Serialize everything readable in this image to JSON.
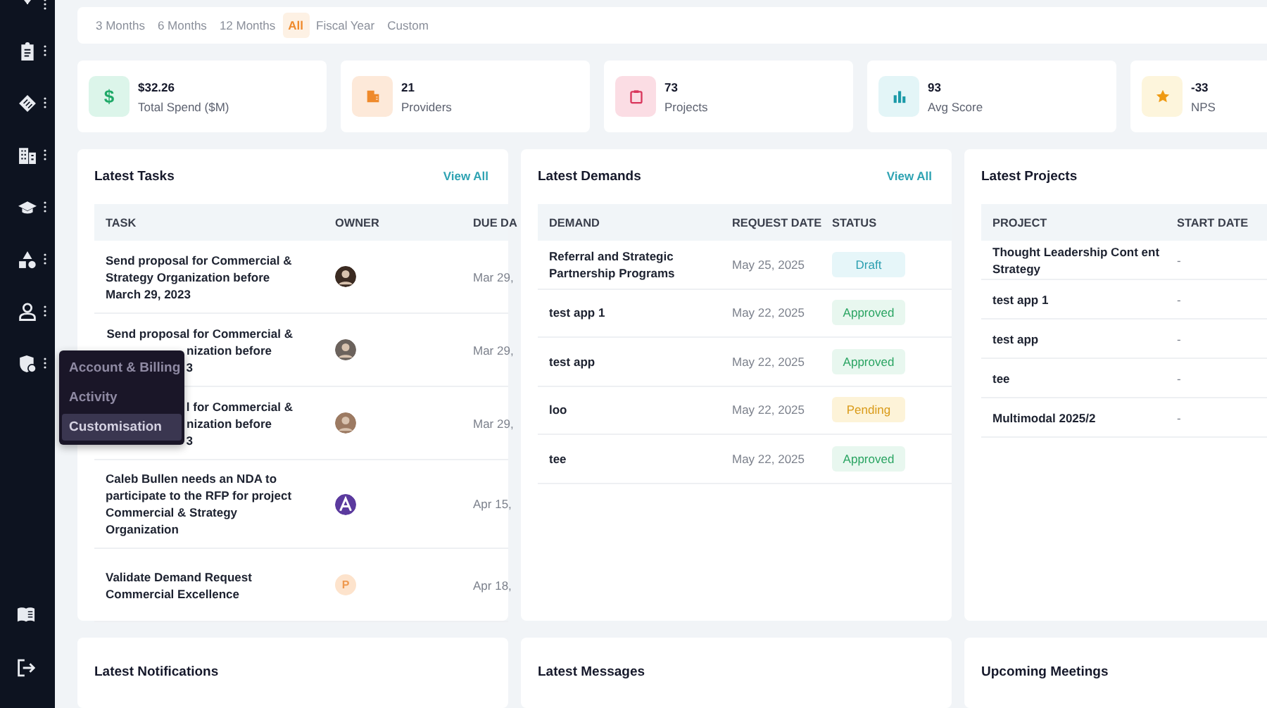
{
  "sidebar_menu": {
    "items": [
      {
        "label": "Account & Billing",
        "selected": false
      },
      {
        "label": "Activity",
        "selected": false
      },
      {
        "label": "Customisation",
        "selected": true
      }
    ]
  },
  "period_filter": [
    {
      "label": "3 Months",
      "selected": false
    },
    {
      "label": "6 Months",
      "selected": false
    },
    {
      "label": "12 Months",
      "selected": false
    },
    {
      "label": "All",
      "selected": true
    },
    {
      "label": "Fiscal Year",
      "selected": false
    },
    {
      "label": "Custom",
      "selected": false
    }
  ],
  "stats": [
    {
      "kind": "spend",
      "icon": "$",
      "value": "$32.26",
      "label": "Total Spend ($M)"
    },
    {
      "kind": "providers",
      "value": "21",
      "label": "Providers"
    },
    {
      "kind": "projects",
      "value": "73",
      "label": "Projects"
    },
    {
      "kind": "score",
      "value": "93",
      "label": "Avg Score"
    },
    {
      "kind": "nps",
      "value": "-33",
      "label": "NPS"
    }
  ],
  "latest_tasks": {
    "title": "Latest Tasks",
    "view_all": "View All",
    "columns": [
      "TASK",
      "OWNER",
      "DUE DA"
    ],
    "rows": [
      {
        "task": "Send proposal for Commercial & Strategy Organization before March 29, 2023",
        "owner": {
          "kind": "photo"
        },
        "due": "Mar 29,"
      },
      {
        "task_lines": [
          "Send proposal for Commercial &",
          "nization before",
          "3"
        ],
        "owner": {
          "kind": "photo"
        },
        "due": "Mar 29,"
      },
      {
        "task_lines": [
          "l for Commercial &",
          "nization before",
          "3"
        ],
        "owner": {
          "kind": "photo"
        },
        "due": "Mar 29,"
      },
      {
        "task": "Caleb Bullen needs an NDA to participate to the RFP for project Commercial & Strategy Organization",
        "owner": {
          "kind": "logo"
        },
        "due": "Apr 15,"
      },
      {
        "task": "Validate Demand Request Commercial Excellence",
        "owner": {
          "kind": "initial",
          "initial": "P"
        },
        "due": "Apr 18,"
      }
    ]
  },
  "latest_demands": {
    "title": "Latest Demands",
    "view_all": "View All",
    "columns": [
      "DEMAND",
      "REQUEST DATE",
      "STATUS"
    ],
    "rows": [
      {
        "demand": "Referral and Strategic Partnership Programs",
        "date": "May 25, 2025",
        "status": {
          "kind": "draft",
          "label": "Draft"
        }
      },
      {
        "demand": "test app 1",
        "date": "May 22, 2025",
        "status": {
          "kind": "approved",
          "label": "Approved"
        }
      },
      {
        "demand": "test app",
        "date": "May 22, 2025",
        "status": {
          "kind": "approved",
          "label": "Approved"
        }
      },
      {
        "demand": "loo",
        "date": "May 22, 2025",
        "status": {
          "kind": "pending",
          "label": "Pending"
        }
      },
      {
        "demand": "tee",
        "date": "May 22, 2025",
        "status": {
          "kind": "approved",
          "label": "Approved"
        }
      }
    ]
  },
  "latest_projects": {
    "title": "Latest Projects",
    "columns": [
      "PROJECT",
      "START DATE"
    ],
    "rows": [
      {
        "project": "Thought Leadership Cont ent Strategy",
        "start": "-"
      },
      {
        "project": "test app 1",
        "start": "-"
      },
      {
        "project": "test app",
        "start": "-"
      },
      {
        "project": "tee",
        "start": "-"
      },
      {
        "project": "Multimodal 2025/2",
        "start": "-"
      }
    ]
  },
  "bottom_panels": [
    {
      "title": "Latest Notifications"
    },
    {
      "title": "Latest Messages"
    },
    {
      "title": "Upcoming Meetings"
    }
  ]
}
